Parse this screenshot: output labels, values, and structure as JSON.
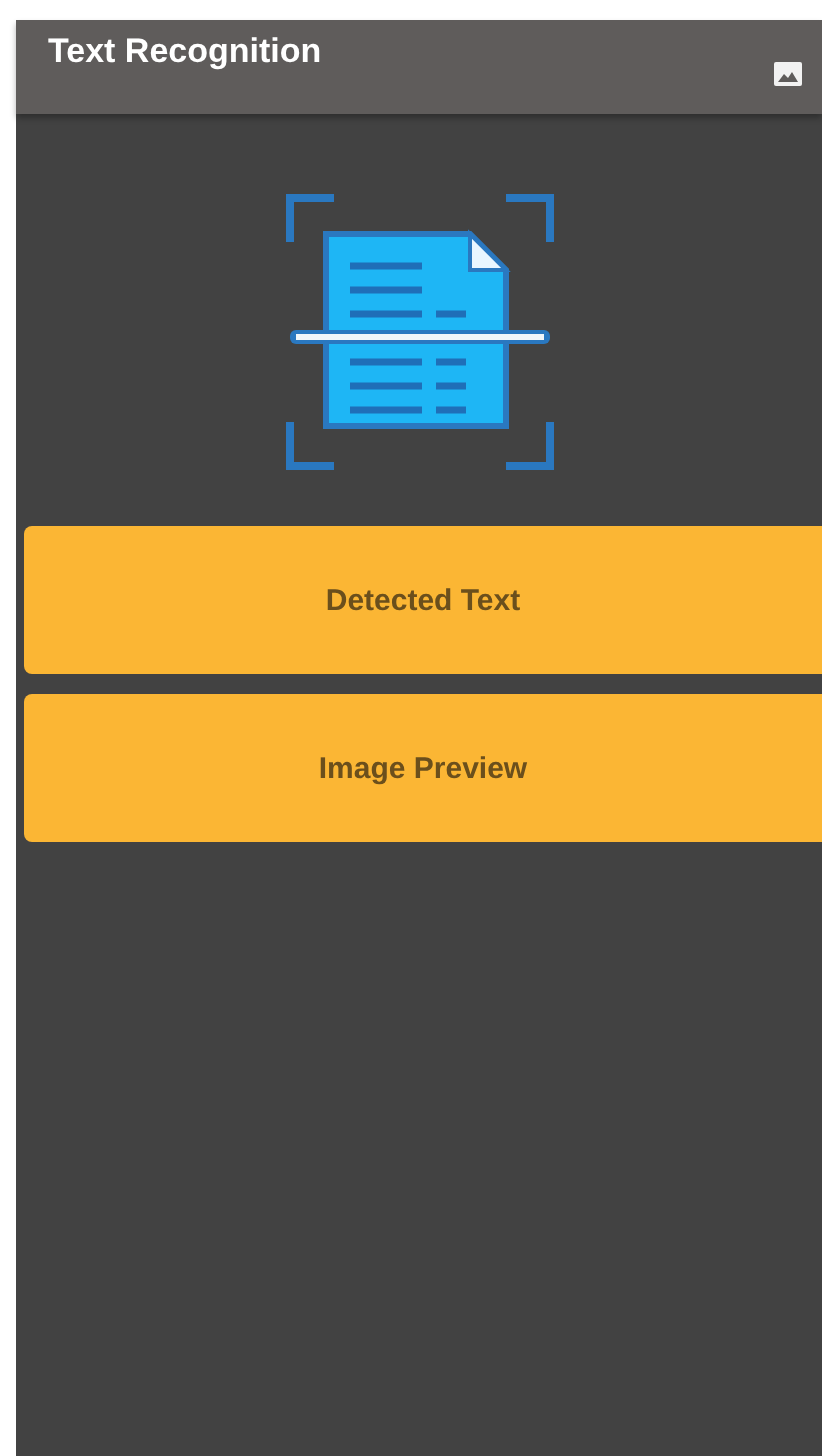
{
  "app_bar": {
    "title": "Text Recognition"
  },
  "buttons": [
    {
      "label": "Detected Text"
    },
    {
      "label": "Image Preview"
    }
  ]
}
